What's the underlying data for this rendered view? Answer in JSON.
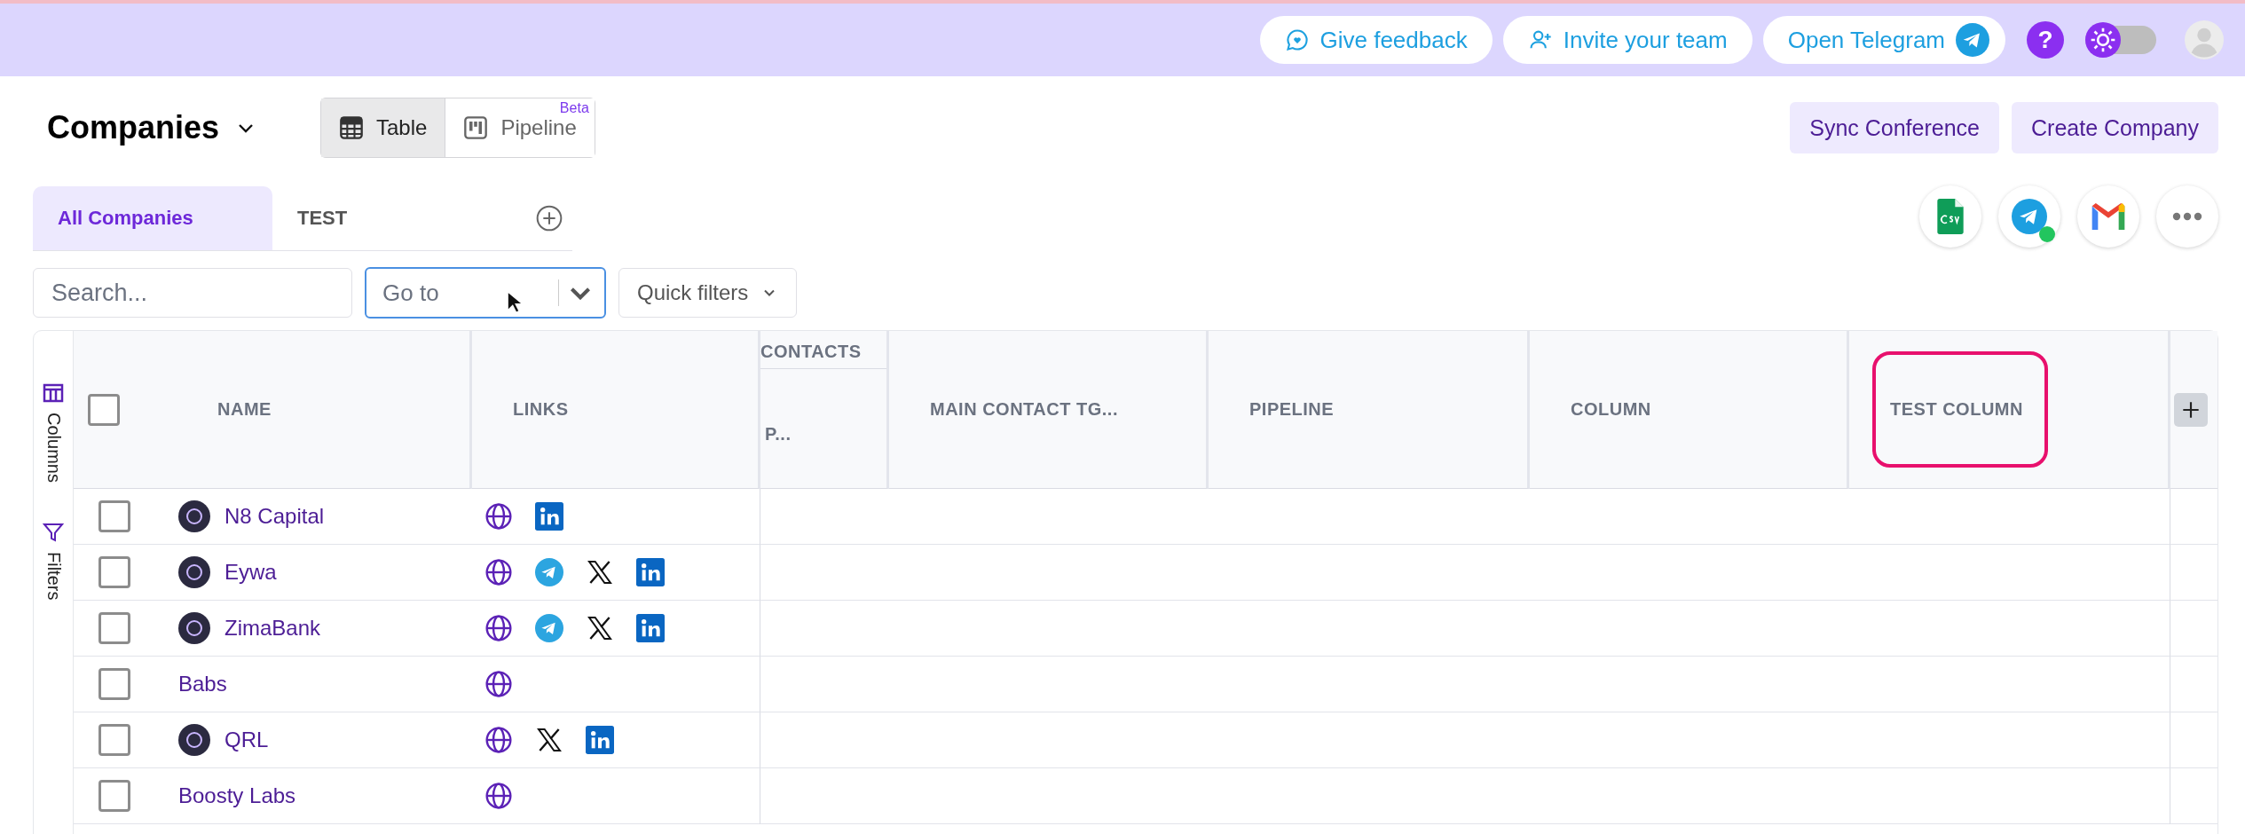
{
  "top_bar": {
    "buttons": [
      {
        "kind": "feedback",
        "label": "Give feedback"
      },
      {
        "kind": "invite",
        "label": "Invite your team"
      },
      {
        "kind": "telegram",
        "label": "Open Telegram"
      }
    ],
    "help_label": "?",
    "theme_toggle": {
      "on": false
    }
  },
  "header": {
    "title": "Companies",
    "views": [
      {
        "kind": "table",
        "label": "Table",
        "selected": true
      },
      {
        "kind": "pipeline",
        "label": "Pipeline",
        "selected": false,
        "badge": "Beta"
      }
    ],
    "actions": [
      "Sync Conference",
      "Create Company"
    ]
  },
  "tabs": [
    {
      "label": "All Companies",
      "selected": true
    },
    {
      "label": "TEST",
      "selected": false
    }
  ],
  "toolbar": {
    "search": {
      "placeholder": "Search..."
    },
    "goto": {
      "placeholder": "Go to"
    },
    "quick_filters": "Quick filters"
  },
  "integrations": [
    {
      "kind": "csv",
      "online": false
    },
    {
      "kind": "telegram",
      "online": true
    },
    {
      "kind": "gmail",
      "online": false
    },
    {
      "kind": "more",
      "online": false
    }
  ],
  "side_panel": [
    {
      "kind": "columns",
      "label": "Columns"
    },
    {
      "kind": "filters",
      "label": "Filters"
    }
  ],
  "table": {
    "header_checked": false,
    "columns": [
      {
        "label": "NAME",
        "highlighted": false
      },
      {
        "label": "LINKS",
        "highlighted": false
      },
      {
        "label": "P...",
        "group": "CONTACTS",
        "highlighted": false
      },
      {
        "label": "MAIN CONTACT TG...",
        "highlighted": false
      },
      {
        "label": "PIPELINE",
        "highlighted": false
      },
      {
        "label": "COLUMN",
        "highlighted": false
      },
      {
        "label": "TEST COLUMN",
        "highlighted": true
      }
    ],
    "rows": [
      {
        "name": "N8 Capital",
        "checked": false,
        "has_logo": true,
        "links": [
          {
            "kind": "web"
          },
          {
            "kind": "linkedin"
          }
        ]
      },
      {
        "name": "Eywa",
        "checked": false,
        "has_logo": true,
        "links": [
          {
            "kind": "web"
          },
          {
            "kind": "telegram"
          },
          {
            "kind": "x"
          },
          {
            "kind": "linkedin"
          }
        ]
      },
      {
        "name": "ZimaBank",
        "checked": false,
        "has_logo": true,
        "links": [
          {
            "kind": "web"
          },
          {
            "kind": "telegram"
          },
          {
            "kind": "x"
          },
          {
            "kind": "linkedin"
          }
        ]
      },
      {
        "name": "Babs",
        "checked": false,
        "has_logo": false,
        "links": [
          {
            "kind": "web"
          }
        ]
      },
      {
        "name": "QRL",
        "checked": false,
        "has_logo": true,
        "links": [
          {
            "kind": "web"
          },
          {
            "kind": "x"
          },
          {
            "kind": "linkedin"
          }
        ]
      },
      {
        "name": "Boosty Labs",
        "checked": false,
        "has_logo": false,
        "links": [
          {
            "kind": "web"
          }
        ]
      }
    ]
  }
}
